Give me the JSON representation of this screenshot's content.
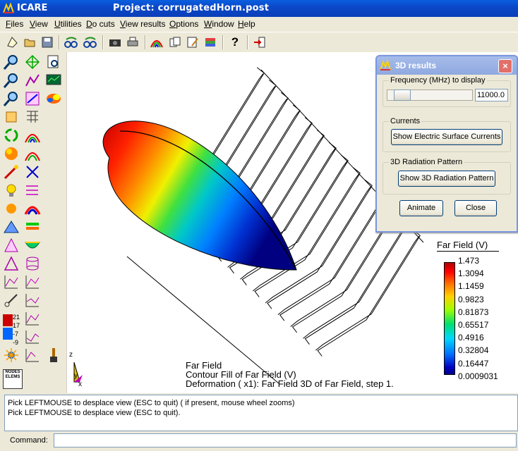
{
  "window": {
    "app_name": "ICARE",
    "project_title": "Project: corrugatedHorn.post"
  },
  "menu": [
    "Files",
    "View",
    "Utilities",
    "Do cuts",
    "View results",
    "Options",
    "Window",
    "Help"
  ],
  "toolbar_icons": [
    "new-icon",
    "open-icon",
    "save-icon",
    "rotate-left-icon",
    "rotate-right-icon",
    "camera-icon",
    "print-icon",
    "rainbow-icon",
    "copy-icon",
    "notes-icon",
    "layers-icon",
    "help-icon",
    "exit-icon"
  ],
  "dialog": {
    "title": "3D results",
    "freq_label": "Frequency (MHz) to display",
    "freq_value": "11000.0",
    "freq_slider_fraction": 0.05,
    "currents_group": "Currents",
    "currents_button": "Show Electric Surface Currents",
    "pattern_group": "3D Radiation Pattern",
    "pattern_button": "Show 3D Radiation Pattern",
    "animate_button": "Animate",
    "close_button": "Close"
  },
  "legend": {
    "title": "Far Field (V)",
    "ticks": [
      "1.473",
      "1.3094",
      "1.1459",
      "0.9823",
      "0.81873",
      "0.65517",
      "0.4916",
      "0.32804",
      "0.16447",
      "0.0009031"
    ]
  },
  "palette": {
    "num_top": "21",
    "num_mid": "17",
    "num_low": "-7",
    "num_bot": "-9",
    "nodes_label": "NODES ELEMS"
  },
  "axes": {
    "z": "z",
    "y": "y",
    "x": "x"
  },
  "caption": {
    "line1": "Far Field",
    "line2": "Contour Fill of Far Field (V)",
    "line3": "Deformation ( x1): Far Field 3D of Far Field, step 1."
  },
  "messages": [
    "Pick LEFTMOUSE to desplace view (ESC to quit) ( if present, mouse wheel zooms)",
    "Pick LEFTMOUSE to desplace view (ESC to quit)."
  ],
  "command_label": "Command:",
  "command_value": ""
}
